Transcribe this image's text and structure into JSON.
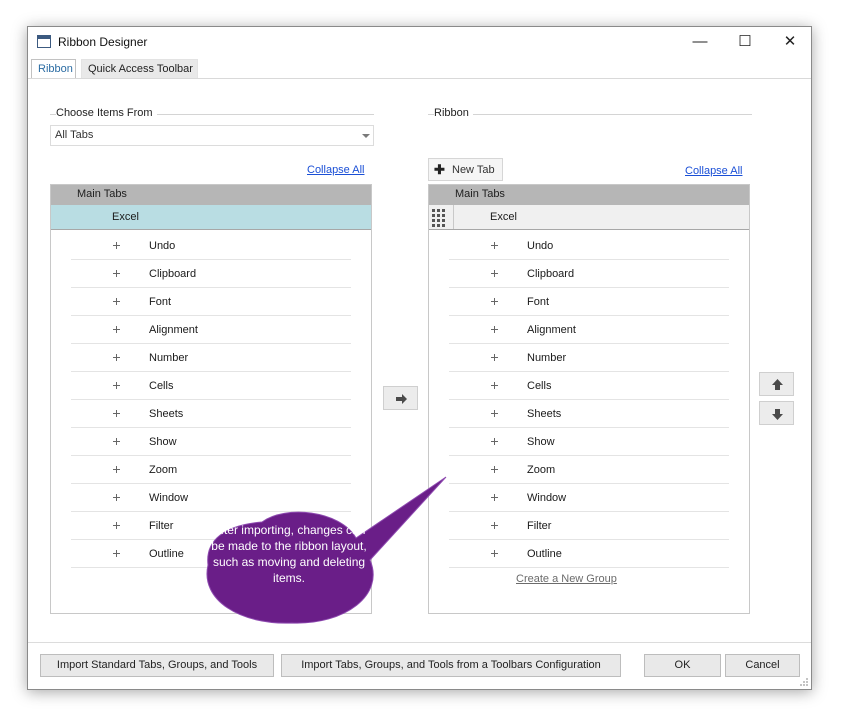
{
  "window": {
    "title": "Ribbon Designer",
    "minimize": "—",
    "maximize": "☐",
    "close": "✕"
  },
  "tabs": [
    {
      "label": "Ribbon",
      "active": true
    },
    {
      "label": "Quick Access Toolbar",
      "active": false
    }
  ],
  "left": {
    "group_label": "Choose Items From",
    "combo_value": "All Tabs",
    "collapse_all": "Collapse All",
    "header": "Main Tabs",
    "tab_name": "Excel",
    "items": [
      "Undo",
      "Clipboard",
      "Font",
      "Alignment",
      "Number",
      "Cells",
      "Sheets",
      "Show",
      "Zoom",
      "Window",
      "Filter",
      "Outline"
    ]
  },
  "right": {
    "group_label": "Ribbon",
    "new_tab": "New Tab",
    "collapse_all": "Collapse All",
    "header": "Main Tabs",
    "tab_name": "Excel",
    "items": [
      "Undo",
      "Clipboard",
      "Font",
      "Alignment",
      "Number",
      "Cells",
      "Sheets",
      "Show",
      "Zoom",
      "Window",
      "Filter",
      "Outline"
    ],
    "create_group": "Create a New Group"
  },
  "buttons": {
    "import_standard": "Import Standard Tabs, Groups, and Tools",
    "import_toolbars": "Import Tabs, Groups, and Tools from a Toolbars Configuration",
    "ok": "OK",
    "cancel": "Cancel"
  },
  "callout": {
    "text": "After importing, changes can be made to the ribbon layout, such as moving and deleting items.",
    "color": "#6a1e88"
  },
  "colors": {
    "selected_row": "#b9dde3",
    "header_bg": "#b6b6b6",
    "link": "#1a4fd6",
    "active_tab": "#2b6ca3"
  }
}
